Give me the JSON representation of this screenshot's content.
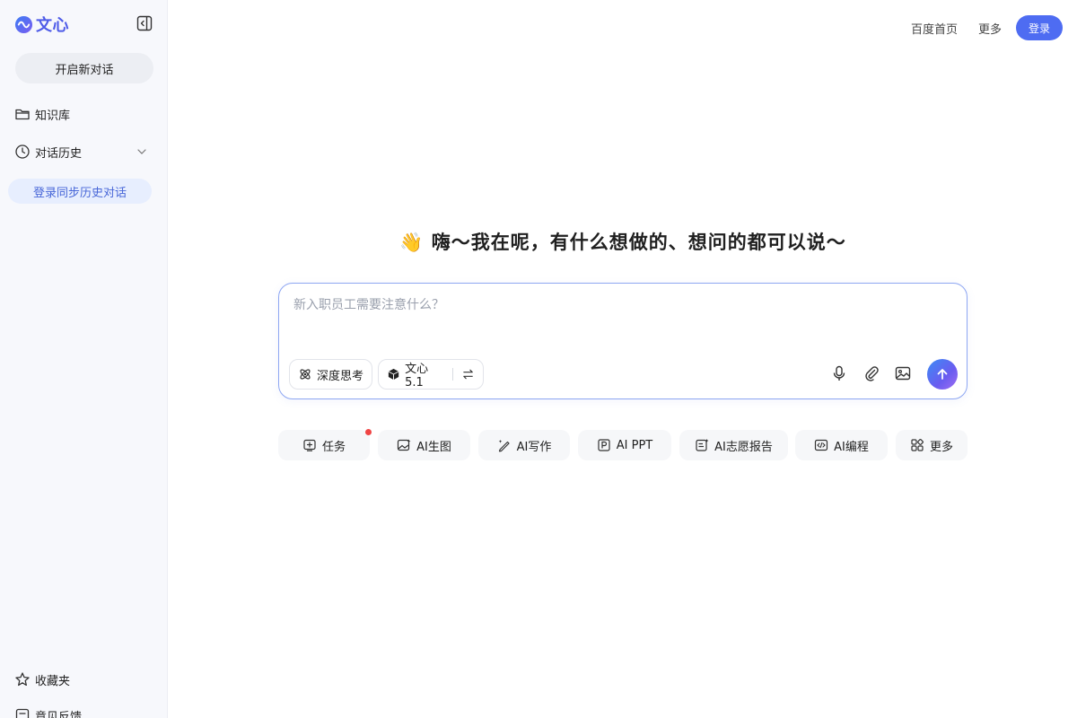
{
  "brand": {
    "name": "文心",
    "accent": "#4e5be8"
  },
  "sidebar": {
    "new_chat": "开启新对话",
    "knowledge": "知识库",
    "history": "对话历史",
    "login_sync": "登录同步历史对话",
    "favorites": "收藏夹",
    "feedback": "意见反馈"
  },
  "topbar": {
    "home": "百度首页",
    "more": "更多",
    "login": "登录",
    "login_color": "#4e6cf2"
  },
  "greeting": "👋 嗨～我在呢，有什么想做的、想问的都可以说～",
  "chat": {
    "placeholder": "新入职员工需要注意什么？",
    "deep_think": "深度思考",
    "model": "文心5.1"
  },
  "shortcuts": {
    "task": "任务",
    "image": "AI生图",
    "write": "AI写作",
    "ppt": "AI PPT",
    "report": "AI志愿报告",
    "code": "AI编程",
    "more": "更多"
  },
  "icons": [
    "wenxin-logo-icon",
    "sidebar-collapse-icon",
    "folder-icon",
    "clock-icon",
    "chevron-down-icon",
    "star-icon",
    "feedback-icon",
    "atom-icon",
    "cube-icon",
    "swap-icon",
    "mic-icon",
    "paperclip-icon",
    "image-icon",
    "arrow-up-icon",
    "task-icon",
    "image-gen-icon",
    "pen-icon",
    "ppt-icon",
    "report-icon",
    "code-icon",
    "grid-icon"
  ]
}
